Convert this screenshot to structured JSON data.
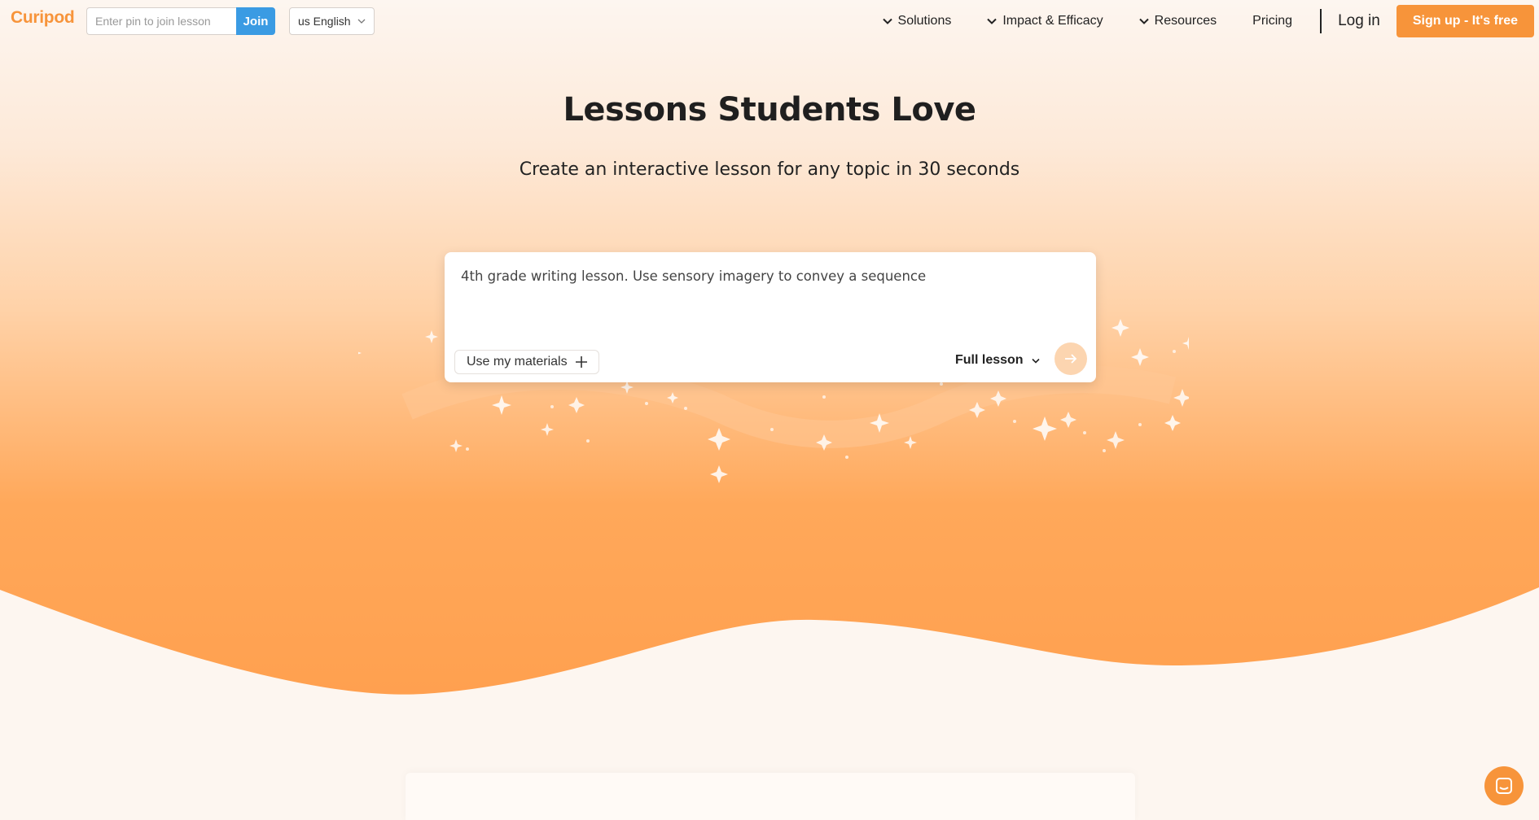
{
  "nav": {
    "logo": "Curipod",
    "pin_placeholder": "Enter pin to join lesson",
    "join_label": "Join",
    "language": "us English",
    "links": [
      {
        "label": "Solutions"
      },
      {
        "label": "Impact & Efficacy"
      },
      {
        "label": "Resources"
      },
      {
        "label": "Pricing"
      }
    ],
    "login_label": "Log in",
    "signup_label": "Sign up - It's free"
  },
  "hero": {
    "title": "Lessons Students Love",
    "subtitle": "Create an interactive lesson for any topic in 30 seconds"
  },
  "prompt": {
    "value": "4th grade writing lesson. Use sensory imagery to convey a sequence",
    "materials_label": "Use my materials",
    "mode_label": "Full lesson"
  },
  "colors": {
    "brand_orange": "#f7943a",
    "join_blue": "#3a9be3",
    "background": "#fdf6f0"
  },
  "icons": {
    "dropdown": "chevron-down-icon",
    "add": "plus-icon",
    "submit": "arrow-right-icon",
    "chat": "chat-icon"
  }
}
